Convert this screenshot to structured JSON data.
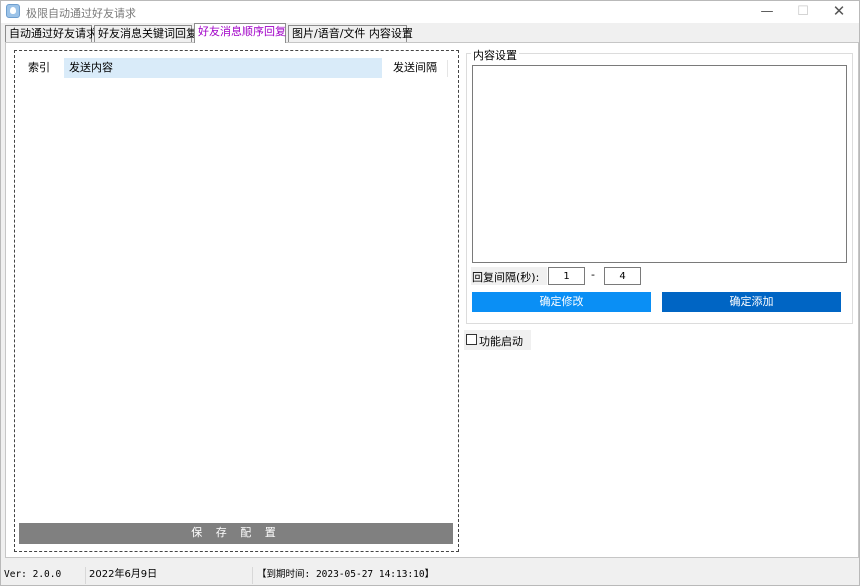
{
  "window": {
    "title": "极限自动通过好友请求",
    "controls": {
      "minimize": "—",
      "maximize": "☐",
      "close": "✕"
    }
  },
  "tabs": [
    {
      "label": "自动通过好友请求",
      "active": false
    },
    {
      "label": "好友消息关键词回复",
      "active": false
    },
    {
      "label": "好友消息顺序回复",
      "active": true
    },
    {
      "label": "图片/语音/文件 内容设置",
      "active": false
    }
  ],
  "list": {
    "columns": [
      "索引",
      "发送内容",
      "发送间隔"
    ],
    "rows": []
  },
  "save_button": "保 存 配 置",
  "content_group": {
    "legend": "内容设置",
    "textarea_value": "",
    "interval_label": "回复间隔(秒):",
    "interval_min": "1",
    "interval_separator": "-",
    "interval_max": "4",
    "modify_button": "确定修改",
    "add_button": "确定添加"
  },
  "feature_toggle": {
    "label": "功能启动",
    "checked": false
  },
  "status": {
    "version": "Ver: 2.0.0",
    "date": "2022年6月9日",
    "expire": "【到期时间: 2023-05-27 14:13:10】"
  },
  "colors": {
    "active_tab_text": "#a100c8",
    "header_highlight": "#d9ebf9",
    "modify_button": "#0a8ff5",
    "add_button": "#0065c4",
    "save_button": "#808080"
  }
}
